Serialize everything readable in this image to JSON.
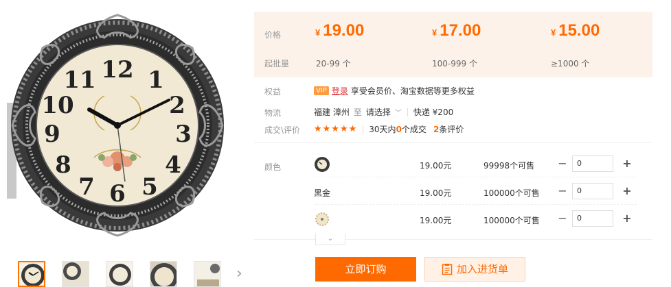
{
  "product": {
    "image_alt": "Clock"
  },
  "gallery": {
    "thumbnail_count": 5,
    "next_arrow": "›"
  },
  "pricing": {
    "price_label": "价格",
    "moq_label": "起批量",
    "currency": "¥",
    "tiers": [
      {
        "price": "19.00",
        "range": "20-99 个"
      },
      {
        "price": "17.00",
        "range": "100-999 个"
      },
      {
        "price": "15.00",
        "range": "≥1000 个"
      }
    ]
  },
  "benefits": {
    "label": "权益",
    "vip_badge": "VIP",
    "login_link": "登录",
    "text": "享受会员价、淘宝数据等更多权益"
  },
  "logistics": {
    "label": "物流",
    "origin": "福建 漳州",
    "to": "至",
    "select": "请选择",
    "express": "快递 ¥200"
  },
  "reviews": {
    "label": "成交\\评价",
    "stars": "★★★★★",
    "rating": 5,
    "deals_prefix": "30天内",
    "deals_count": "0",
    "deals_suffix": "个成交",
    "review_count": "2",
    "review_suffix": "条评价"
  },
  "sku": {
    "label": "颜色",
    "items": [
      {
        "name": "",
        "price": "19.00元",
        "stock": "99998个可售",
        "qty": "0"
      },
      {
        "name": "黑金",
        "price": "19.00元",
        "stock": "100000个可售",
        "qty": "0"
      },
      {
        "name": "",
        "price": "19.00元",
        "stock": "100000个可售",
        "qty": "0"
      }
    ],
    "minus": "−",
    "plus": "+",
    "expand": "⌄"
  },
  "actions": {
    "order": "立即订购",
    "cart": "加入进货单"
  },
  "colors": {
    "accent": "#ff6a00",
    "price_bg": "#fdf2ea",
    "login_red": "#e4393c"
  }
}
